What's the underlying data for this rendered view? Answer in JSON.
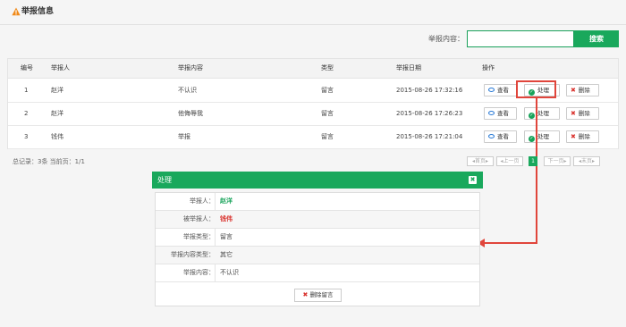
{
  "page": {
    "title": "举报信息",
    "icon": "warning-icon"
  },
  "search": {
    "label": "举报内容：",
    "value": "",
    "placeholder": "",
    "button_label": "搜索"
  },
  "table": {
    "headers": [
      "编号",
      "举报人",
      "举报内容",
      "类型",
      "举报日期",
      "操作"
    ],
    "rows": [
      {
        "no": "1",
        "reporter": "赵洋",
        "content": "不认识",
        "type": "留言",
        "date": "2015-08-26 17:32:16"
      },
      {
        "no": "2",
        "reporter": "赵洋",
        "content": "他侮辱我",
        "type": "留言",
        "date": "2015-08-26 17:26:23"
      },
      {
        "no": "3",
        "reporter": "钱伟",
        "content": "举报",
        "type": "留言",
        "date": "2015-08-26 17:21:04"
      }
    ],
    "actions": {
      "view": "查看",
      "handle": "处理",
      "delete": "删除"
    }
  },
  "footer": {
    "summary": "总记录：3条  当前页：1/1"
  },
  "pagination": {
    "first": "◂首页▸",
    "prev": "◂上一页",
    "current": "1",
    "next": "下一页▸",
    "last": "◂末页▸"
  },
  "panel": {
    "title": "处理",
    "close_icon": "close-icon",
    "fields": [
      {
        "label": "举报人：",
        "value": "赵洋",
        "style": "green"
      },
      {
        "label": "被举报人：",
        "value": "钱伟",
        "style": "red"
      },
      {
        "label": "举报类型：",
        "value": "留言",
        "style": "plain"
      },
      {
        "label": "举报内容类型：",
        "value": "其它",
        "style": "plain"
      },
      {
        "label": "举报内容：",
        "value": "不认识",
        "style": "plain"
      }
    ],
    "delete_button": "删除留言"
  },
  "colors": {
    "accent": "#19a85c",
    "highlight": "#e0453b",
    "view_icon": "#2b7bd6",
    "delete_icon": "#d9332e"
  }
}
